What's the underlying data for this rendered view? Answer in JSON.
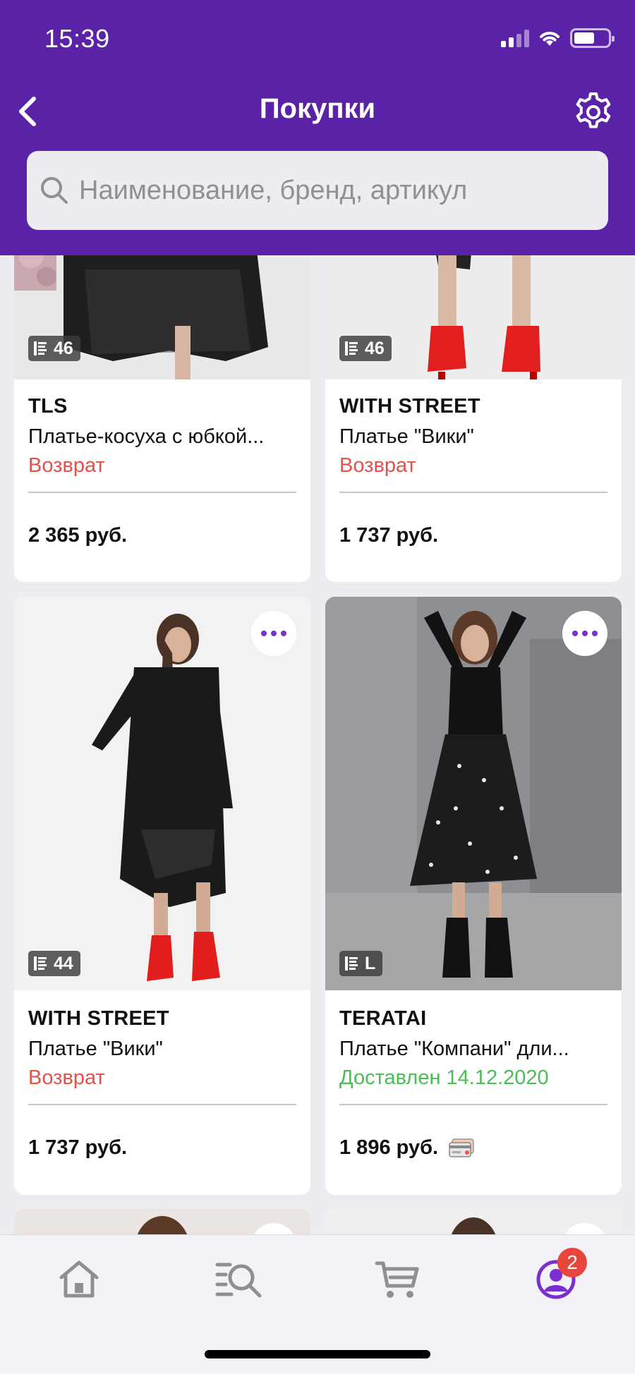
{
  "status_bar": {
    "time": "15:39"
  },
  "header": {
    "title": "Покупки",
    "search_placeholder": "Наименование, бренд, артикул"
  },
  "products": [
    {
      "brand": "TLS",
      "name": "Платье-косуха с юбкой...",
      "status": "Возврат",
      "status_type": "return",
      "price": "2 365 руб.",
      "size": "46"
    },
    {
      "brand": "WITH STREET",
      "name": "Платье \"Вики\"",
      "status": "Возврат",
      "status_type": "return",
      "price": "1 737 руб.",
      "size": "46"
    },
    {
      "brand": "WITH STREET",
      "name": "Платье \"Вики\"",
      "status": "Возврат",
      "status_type": "return",
      "price": "1 737 руб.",
      "size": "44"
    },
    {
      "brand": "TERATAI",
      "name": "Платье \"Компани\" дли...",
      "status": "Доставлен 14.12.2020",
      "status_type": "delivered",
      "price": "1 896 руб.",
      "size": "L",
      "card_payment_icon": "credit-card-icon"
    }
  ],
  "tabbar": {
    "tabs": [
      {
        "icon": "home-icon"
      },
      {
        "icon": "catalog-search-icon"
      },
      {
        "icon": "cart-icon"
      },
      {
        "icon": "profile-icon",
        "active": true,
        "badge": "2"
      }
    ]
  },
  "colors": {
    "brand_purple": "#5a22a6",
    "accent_purple": "#7b2fd0",
    "return_red": "#e2524a",
    "delivered_green": "#4cbc55",
    "badge_red": "#e8453c"
  }
}
